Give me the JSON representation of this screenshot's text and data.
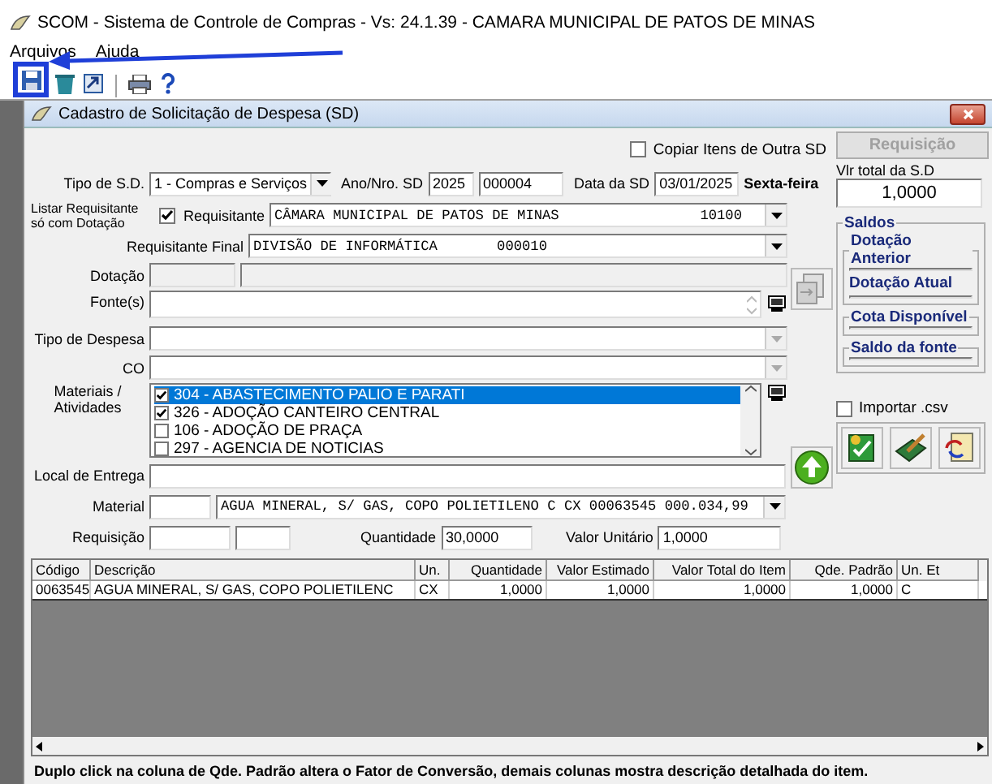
{
  "window": {
    "title": "SCOM - Sistema de Controle de Compras - Vs: 24.1.39 - CAMARA MUNICIPAL DE PATOS DE MINAS"
  },
  "menu": [
    "Arquivos",
    "Ajuda"
  ],
  "toolbar": [
    {
      "kind": "save",
      "highlighted": true
    },
    {
      "kind": "bin",
      "highlighted": false
    },
    {
      "kind": "export",
      "highlighted": false
    },
    {
      "kind": "print",
      "highlighted": false
    },
    {
      "kind": "help",
      "highlighted": false
    }
  ],
  "child_window": {
    "title": "Cadastro de Solicitação de Despesa (SD)"
  },
  "form": {
    "copy_items": {
      "label": "Copiar Itens de  Outra SD",
      "checked": false
    },
    "requisicao_button": {
      "label": "Requisição",
      "disabled": true
    },
    "total": {
      "label": "Vlr total da S.D",
      "value": "1,0000"
    },
    "tipo_sd": {
      "label": "Tipo de S.D.",
      "value": "1 - Compras e Serviços"
    },
    "ano_nro": {
      "label": "Ano/Nro. SD",
      "year": "2025",
      "number": "000004"
    },
    "data_sd": {
      "label": "Data da SD",
      "value": "03/01/2025",
      "weekday": "Sexta-feira"
    },
    "listar": {
      "label": "Listar Requisitante só com Dotação",
      "checked": true
    },
    "requisitante": {
      "label": "Requisitante",
      "value": "CÂMARA MUNICIPAL DE PATOS DE MINAS",
      "code": "10100"
    },
    "requisitante_final": {
      "label": "Requisitante Final",
      "value": "DIVISÃO DE INFORMÁTICA",
      "code": "000010"
    },
    "dotacao": {
      "label": "Dotação"
    },
    "fontes": {
      "label": "Fonte(s)"
    },
    "tipo_despesa": {
      "label": "Tipo de Despesa"
    },
    "co": {
      "label": "CO"
    },
    "materiais": {
      "label": "Materiais / Atividades",
      "items": [
        {
          "text": "304 - ABASTECIMENTO PALIO E PARATI",
          "checked": true,
          "selected": true
        },
        {
          "text": "326 - ADOÇÃO CANTEIRO CENTRAL",
          "checked": true,
          "selected": false
        },
        {
          "text": "106 - ADOÇÃO DE PRAÇA",
          "checked": false,
          "selected": false
        },
        {
          "text": "297 - AGENCIA DE NOTICIAS",
          "checked": false,
          "selected": false
        }
      ]
    },
    "local_entrega": {
      "label": "Local de Entrega"
    },
    "material": {
      "label": "Material",
      "value": "AGUA MINERAL, S/ GAS, COPO POLIETILENO C CX 00063545 000.034,99"
    },
    "requisicao": {
      "label": "Requisição"
    },
    "quantidade": {
      "label": "Quantidade",
      "value": "30,0000"
    },
    "valor_unitario": {
      "label": "Valor Unitário",
      "value": "1,0000"
    },
    "importar_csv": {
      "label": "Importar .csv",
      "checked": false
    }
  },
  "saldos": {
    "title": "Saldos",
    "groups": [
      {
        "labels": [
          "Dotação Anterior",
          "Dotação Atual"
        ]
      },
      {
        "labels": [
          "Cota Disponível"
        ]
      },
      {
        "labels": [
          "Saldo da fonte"
        ]
      }
    ]
  },
  "table": {
    "columns": [
      "Código",
      "Descrição",
      "Un.",
      "Quantidade",
      "Valor Estimado",
      "Valor Total do Item",
      "Qde. Padrão",
      "Un. Et"
    ],
    "rows": [
      [
        "0063545",
        "AGUA MINERAL, S/ GAS, COPO POLIETILENC",
        "CX",
        "1,0000",
        "1,0000",
        "1,0000",
        "1,0000",
        "C"
      ]
    ]
  },
  "status": "Duplo click na coluna de Qde. Padrão altera o Fator de Conversão, demais colunas mostra descrição detalhada do item."
}
